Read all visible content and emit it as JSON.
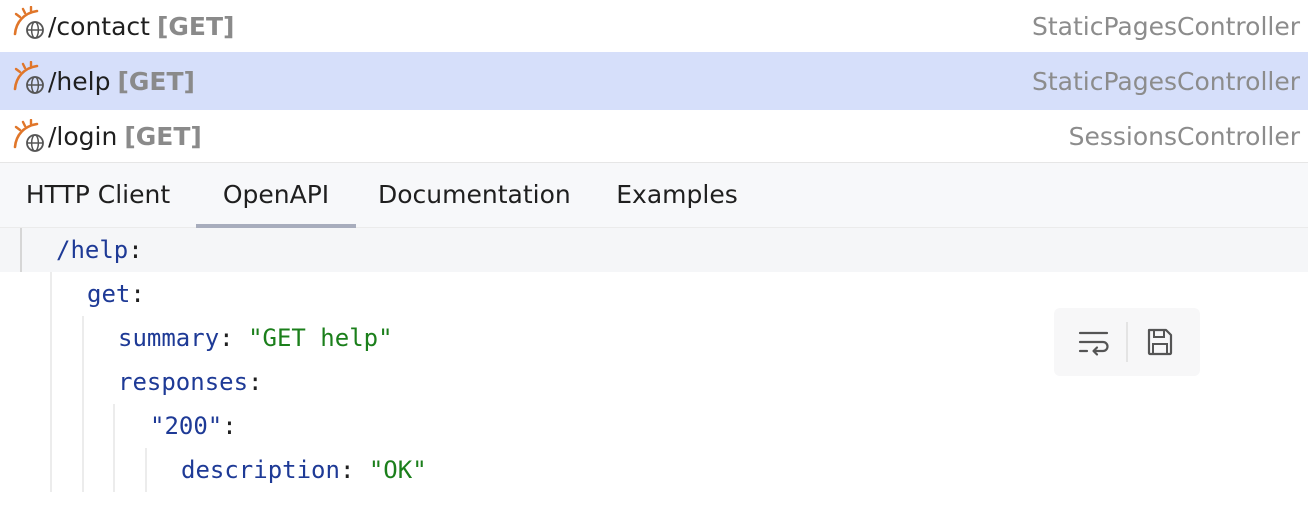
{
  "routes": [
    {
      "path": "/contact",
      "method": "[GET]",
      "controller": "StaticPagesController",
      "selected": false
    },
    {
      "path": "/help",
      "method": "[GET]",
      "controller": "StaticPagesController",
      "selected": true
    },
    {
      "path": "/login",
      "method": "[GET]",
      "controller": "SessionsController",
      "selected": false
    }
  ],
  "tabs": [
    {
      "label": "HTTP Client",
      "active": false
    },
    {
      "label": "OpenAPI",
      "active": true
    },
    {
      "label": "Documentation",
      "active": false
    },
    {
      "label": "Examples",
      "active": false
    }
  ],
  "code": {
    "line1_key": "/help",
    "colon": ":",
    "line2_key": "get",
    "line3_key": "summary",
    "line3_sep": ": ",
    "line3_val": "\"GET help\"",
    "line4_key": "responses",
    "line5_key": "\"200\"",
    "line6_key": "description",
    "line6_sep": ": ",
    "line6_val": "\"OK\""
  },
  "toolbar": {
    "icons": [
      "soft-wrap-icon",
      "save-icon"
    ]
  },
  "colors": {
    "selected_row": "#d6dffa",
    "yaml_key": "#1e3a96",
    "yaml_string": "#1b7f1b",
    "route_icon": "#e0762a"
  }
}
